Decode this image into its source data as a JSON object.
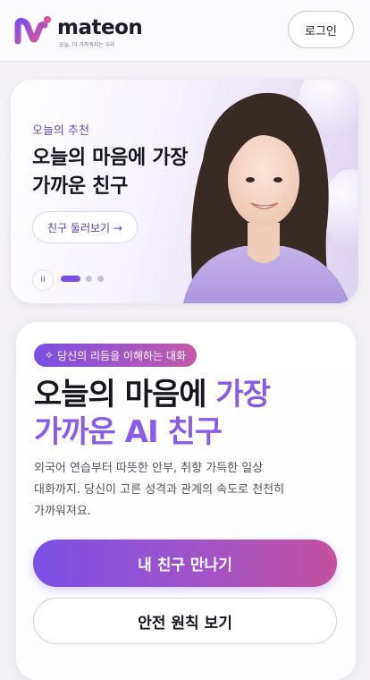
{
  "header": {
    "brand": "mateon",
    "tagline": "오늘, 더 가까워지는 우리",
    "login_label": "로그인"
  },
  "hero": {
    "eyebrow": "오늘의 추천",
    "title_line1": "오늘의 마음에 가장",
    "title_line2": "가까운 친구",
    "cta_label": "친구 둘러보기 →",
    "pause_symbol": "II",
    "carousel": {
      "slide_count": 3,
      "active_index": 0
    }
  },
  "main": {
    "badge_icon": "✧",
    "badge_label": "당신의 리듬을 이해하는 대화",
    "title_part1": "오늘의 마음에 ",
    "title_part2": "가장",
    "title_part3": "가까운 AI 친구",
    "description_line1": "외국어 연습부터 따뜻한 안부, 취향 가득한 일상",
    "description_line2": "대화까지. 당신이 고른 성격과 관계의 속도로 천천히",
    "description_line3": "가까워져요.",
    "primary_label": "내 친구 만나기",
    "secondary_label": "안전 원칙 보기"
  },
  "colors": {
    "accent": "#8a5be8",
    "gradient_start": "#7b4fe6",
    "gradient_end": "#c4509f"
  }
}
